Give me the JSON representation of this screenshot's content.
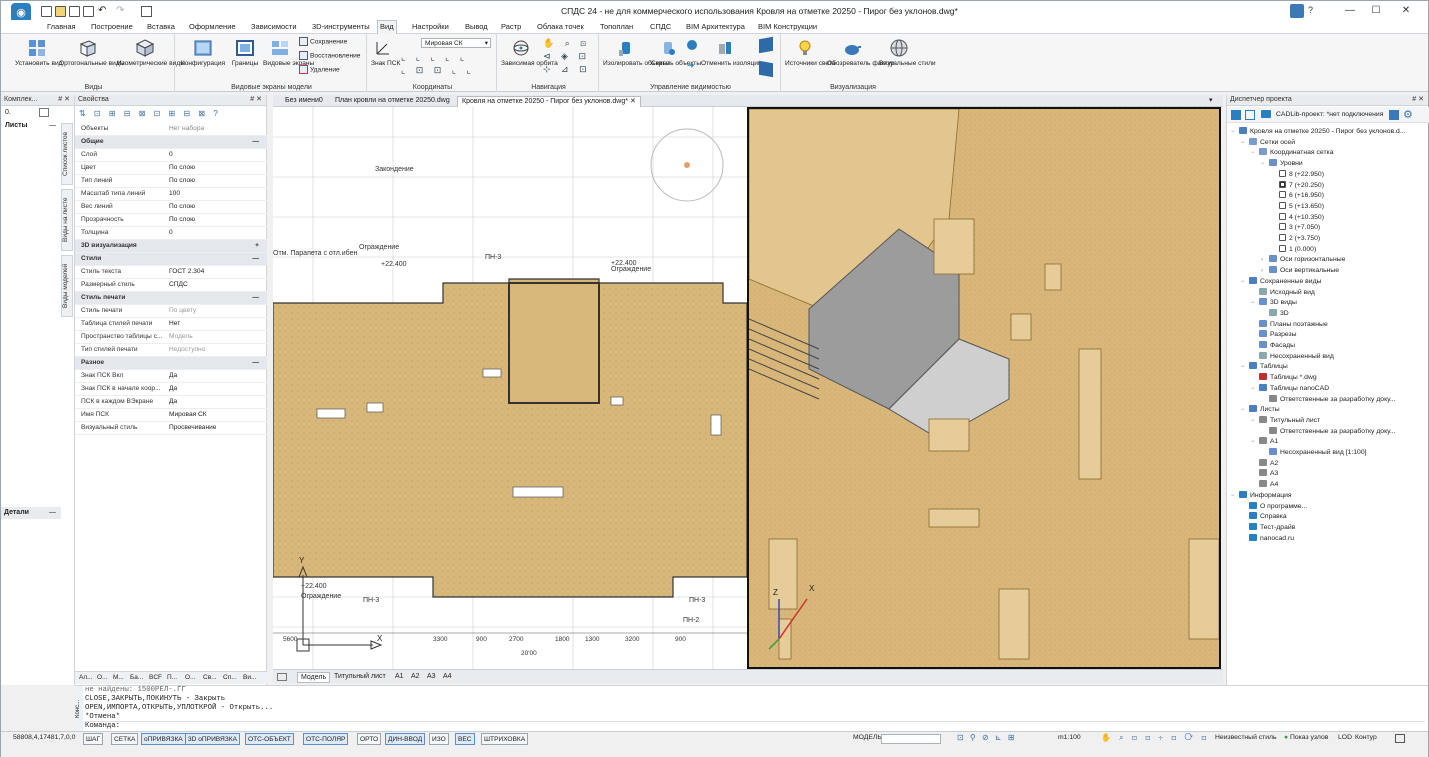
{
  "window": {
    "title": "СПДС 24 - не для коммерческого использования Кровля на отметке 20250 - Пирог без уклонов.dwg*",
    "help_label": "?",
    "controls": [
      "—",
      "☐",
      "✕"
    ]
  },
  "ribbon_tabs": [
    "Главная",
    "Построение",
    "Вставка",
    "Оформление",
    "Зависимости",
    "3D-инструменты",
    "Вид",
    "Настройки",
    "Вывод",
    "Растр",
    "Облака точек",
    "Топоплан",
    "СПДС",
    "BIM Архитектура",
    "BIM Конструкции"
  ],
  "active_tab": "Вид",
  "ribbon": {
    "groups": [
      {
        "label": "Виды",
        "buttons": [
          "Установить вид",
          "Ортогональные виды",
          "Изометрические виды"
        ]
      },
      {
        "label": "Видовые экраны модели",
        "buttons": [
          "Конфигурация",
          "Границы",
          "Видовые экраны"
        ],
        "small": [
          "Сохранение",
          "Восстановление",
          "Удаление"
        ]
      },
      {
        "label": "Координаты",
        "buttons": [
          "Знак ПСК"
        ],
        "combo": "Мировая СК"
      },
      {
        "label": "Навигация",
        "buttons": [
          "Зависимая орбита"
        ]
      },
      {
        "label": "Управление видимостью",
        "buttons": [
          "Изолировать объекты",
          "Скрыть объекты",
          "Отменить изоляцию"
        ]
      },
      {
        "label": "Визуализация",
        "buttons": [
          "Источники света",
          "Обозреватель фактур",
          "Визуальные стили"
        ]
      }
    ]
  },
  "left_panel": {
    "header": "Комплек...",
    "header_pin": "# ✕",
    "sheets_label": "Листы",
    "details_label": "Детали",
    "zoom_value": "0.",
    "vertical_tabs": [
      "Список листов",
      "Виды на листе",
      "Виды моделей"
    ]
  },
  "properties": {
    "header": "Свойства",
    "objects_name": "Объекты",
    "objects_value": "Нет набора",
    "rows": [
      {
        "type": "cat",
        "name": "Общие",
        "toggle": "—"
      },
      {
        "type": "row",
        "name": "Слой",
        "value": "0"
      },
      {
        "type": "row",
        "name": "Цвет",
        "value": "По слою"
      },
      {
        "type": "row",
        "name": "Тип линий",
        "value": "По слою"
      },
      {
        "type": "row",
        "name": "Масштаб типа линий",
        "value": "100"
      },
      {
        "type": "row",
        "name": "Вес линий",
        "value": "По слою"
      },
      {
        "type": "row",
        "name": "Прозрачность",
        "value": "По слою"
      },
      {
        "type": "row",
        "name": "Толщина",
        "value": "0"
      },
      {
        "type": "cat",
        "name": "3D визуализация",
        "toggle": "+"
      },
      {
        "type": "cat",
        "name": "Стили",
        "toggle": "—"
      },
      {
        "type": "row",
        "name": "Стиль текста",
        "value": "ГОСТ 2.304"
      },
      {
        "type": "row",
        "name": "Размерный стиль",
        "value": "СПДС"
      },
      {
        "type": "cat",
        "name": "Стиль печати",
        "toggle": "—"
      },
      {
        "type": "row",
        "name": "Стиль печати",
        "value": "По цвету"
      },
      {
        "type": "row",
        "name": "Таблица стилей печати",
        "value": "Нет"
      },
      {
        "type": "row",
        "name": "Пространство таблицы с...",
        "value": "Модель"
      },
      {
        "type": "row",
        "name": "Тип стилей печати",
        "value": "Недоступно"
      },
      {
        "type": "cat",
        "name": "Разное",
        "toggle": "—"
      },
      {
        "type": "row",
        "name": "Знак ПСК Вкл",
        "value": "Да"
      },
      {
        "type": "row",
        "name": "Знак ПСК в начале коор...",
        "value": "Да"
      },
      {
        "type": "row",
        "name": "ПСК в каждом ВЭкране",
        "value": "Да"
      },
      {
        "type": "row",
        "name": "Имя ПСК",
        "value": "Мировая СК"
      },
      {
        "type": "row",
        "name": "Визуальный стиль",
        "value": "Просвечивание"
      }
    ],
    "bottom_tabs": [
      "Ал...",
      "О...",
      "М...",
      "Ба...",
      "BCF",
      "П...",
      "О...",
      "Св...",
      "Сп...",
      "Ви..."
    ]
  },
  "doc_tabs": [
    "Без имени0",
    "План кровли на отметке 20250.dwg",
    "Кровля на отметке 20250 - Пирог без уклонов.dwg*"
  ],
  "active_doc": 2,
  "drawing": {
    "labels": [
      "Ограждение",
      "+22.400",
      "ПН-3",
      "ПН-2",
      "Отм. Парапета с отл.ибен",
      "Закондение",
      "ось Y",
      "X",
      "Y",
      "3300",
      "2700",
      "1800",
      "1300",
      "3200",
      "900",
      "5600",
      "+22.400",
      "Ограждение"
    ],
    "dims": [
      "3300",
      "900",
      "2700",
      "1800",
      "1300",
      "3200",
      "900",
      "5600",
      "20'00"
    ]
  },
  "layout_tabs": [
    "Модель",
    "Титульный лист",
    "A1",
    "A2",
    "A3",
    "A4"
  ],
  "active_layout": "Модель",
  "project_tree": {
    "header": "Диспетчер проекта",
    "header_pin": "# ✕",
    "project_label": "CADLib-проект: *нет подключения",
    "nodes": [
      {
        "level": 0,
        "label": "Кровля на отметке 20250 - Пирог без уклонов.d...",
        "icon": "#4a7fc0",
        "toggle": "−"
      },
      {
        "level": 1,
        "label": "Сетки осей",
        "icon": "#7a9ad0",
        "toggle": "−"
      },
      {
        "level": 2,
        "label": "Координатная сетка",
        "icon": "#7a9ad0",
        "toggle": "−"
      },
      {
        "level": 3,
        "label": "Уровни",
        "icon": "#6b8fc8",
        "toggle": "−"
      },
      {
        "level": 4,
        "label": "8 (+22.950)",
        "icon": "check",
        "toggle": ""
      },
      {
        "level": 4,
        "label": "7 (+20.250)",
        "icon": "checked",
        "toggle": ""
      },
      {
        "level": 4,
        "label": "6 (+16.950)",
        "icon": "check",
        "toggle": ""
      },
      {
        "level": 4,
        "label": "5 (+13.650)",
        "icon": "check",
        "toggle": ""
      },
      {
        "level": 4,
        "label": "4 (+10.350)",
        "icon": "check",
        "toggle": ""
      },
      {
        "level": 4,
        "label": "3 (+7.050)",
        "icon": "check",
        "toggle": ""
      },
      {
        "level": 4,
        "label": "2 (+3.750)",
        "icon": "check",
        "toggle": ""
      },
      {
        "level": 4,
        "label": "1 (0.000)",
        "icon": "check",
        "toggle": ""
      },
      {
        "level": 3,
        "label": "Оси горизонтальные",
        "icon": "#6b8fc8",
        "toggle": "›"
      },
      {
        "level": 3,
        "label": "Оси вертикальные",
        "icon": "#6b8fc8",
        "toggle": "›"
      },
      {
        "level": 1,
        "label": "Сохраненные виды",
        "icon": "#4a7fc0",
        "toggle": "−"
      },
      {
        "level": 2,
        "label": "Исходный вид",
        "icon": "#8aa",
        "toggle": ""
      },
      {
        "level": 2,
        "label": "3D виды",
        "icon": "#6b8fc8",
        "toggle": "−"
      },
      {
        "level": 3,
        "label": "3D",
        "icon": "#8aa",
        "toggle": ""
      },
      {
        "level": 2,
        "label": "Планы поэтажные",
        "icon": "#6b8fc8",
        "toggle": ""
      },
      {
        "level": 2,
        "label": "Разрезы",
        "icon": "#6b8fc8",
        "toggle": ""
      },
      {
        "level": 2,
        "label": "Фасады",
        "icon": "#6b8fc8",
        "toggle": ""
      },
      {
        "level": 2,
        "label": "Несохраненный вид",
        "icon": "#8aa",
        "toggle": ""
      },
      {
        "level": 1,
        "label": "Таблицы",
        "icon": "#4a7fc0",
        "toggle": "−"
      },
      {
        "level": 2,
        "label": "Таблицы *.dwg",
        "icon": "#c03030",
        "toggle": ""
      },
      {
        "level": 2,
        "label": "Таблицы nanoCAD",
        "icon": "#4a7fc0",
        "toggle": "−"
      },
      {
        "level": 3,
        "label": "Ответственные за разработку доку...",
        "icon": "#888",
        "toggle": ""
      },
      {
        "level": 1,
        "label": "Листы",
        "icon": "#4a7fc0",
        "toggle": "−"
      },
      {
        "level": 2,
        "label": "Титульный лист",
        "icon": "#888",
        "toggle": "−"
      },
      {
        "level": 3,
        "label": "Ответственные за разработку доку...",
        "icon": "#888",
        "toggle": ""
      },
      {
        "level": 2,
        "label": "A1",
        "icon": "#888",
        "toggle": "−"
      },
      {
        "level": 3,
        "label": "Несохраненный вид [1:100]",
        "icon": "#6b8fc8",
        "toggle": ""
      },
      {
        "level": 2,
        "label": "A2",
        "icon": "#888",
        "toggle": ""
      },
      {
        "level": 2,
        "label": "A3",
        "icon": "#888",
        "toggle": ""
      },
      {
        "level": 2,
        "label": "A4",
        "icon": "#888",
        "toggle": ""
      },
      {
        "level": 0,
        "label": "Информация",
        "icon": "#2a7fc1",
        "toggle": "−"
      },
      {
        "level": 1,
        "label": "О программе...",
        "icon": "#2a7fc1",
        "toggle": ""
      },
      {
        "level": 1,
        "label": "Справка",
        "icon": "#2a7fc1",
        "toggle": ""
      },
      {
        "level": 1,
        "label": "Тест-драйв",
        "icon": "#2a7fc1",
        "toggle": ""
      },
      {
        "level": 1,
        "label": "nanocad.ru",
        "icon": "#2a7fc1",
        "toggle": ""
      }
    ]
  },
  "command_line": {
    "side_label": "Конс...",
    "lines": [
      "не найдены: 1500РЕЛ-.ГГ",
      "CLOSE,ЗАКРЫТЬ,ПОКИНУТЬ - Закрыть",
      "OPEN,ИМПОРТА,ОТКРЫТЬ,УПЛОТКРОЙ - Открыть...",
      "*Отмена*"
    ],
    "prompt": "Команда:"
  },
  "status_bar": {
    "coords": "58808,4,17481,7,0,0",
    "buttons": [
      "ШАГ",
      "СЕТКА",
      "оПРИВЯЗКА",
      "3D оПРИВЯЗКА",
      "ОТС-ОБЪЕКТ",
      "ОТС-ПОЛЯР",
      "ОРТО",
      "ДИН-ВВОД",
      "ИЗО",
      "ВЕС",
      "ШТРИХОВКА"
    ],
    "active_buttons": [
      "оПРИВЯЗКА",
      "3D оПРИВЯЗКА",
      "ОТС-ОБЪЕКТ",
      "ОТС-ПОЛЯР",
      "ДИН-ВВОД",
      "ВЕС"
    ],
    "model_label": "МОДЕЛЬ",
    "scale": "m1:100",
    "style_label": "Неизвестный стиль",
    "nodes_label": "Показ узлов",
    "lod_label": "LOD",
    "contour_label": "Контур"
  }
}
